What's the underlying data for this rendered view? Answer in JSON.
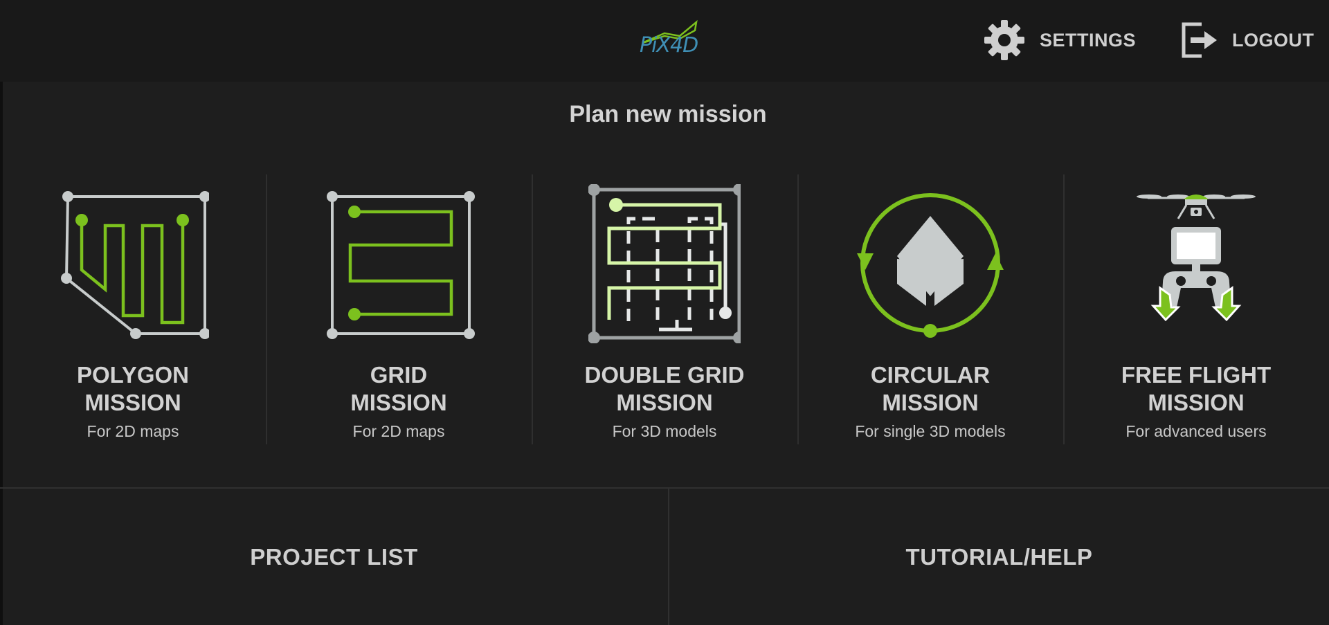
{
  "header": {
    "logo_text": "PiX4D",
    "settings_label": "SETTINGS",
    "logout_label": "LOGOUT"
  },
  "section_title": "Plan new mission",
  "missions": [
    {
      "title_line1": "POLYGON",
      "title_line2": "MISSION",
      "subtitle": "For 2D maps",
      "icon": "polygon-mission-icon"
    },
    {
      "title_line1": "GRID",
      "title_line2": "MISSION",
      "subtitle": "For 2D maps",
      "icon": "grid-mission-icon"
    },
    {
      "title_line1": "DOUBLE GRID",
      "title_line2": "MISSION",
      "subtitle": "For 3D models",
      "icon": "double-grid-mission-icon"
    },
    {
      "title_line1": "CIRCULAR",
      "title_line2": "MISSION",
      "subtitle": "For single 3D models",
      "icon": "circular-mission-icon"
    },
    {
      "title_line1": "FREE FLIGHT",
      "title_line2": "MISSION",
      "subtitle": "For advanced users",
      "icon": "free-flight-mission-icon"
    }
  ],
  "bottom": {
    "project_list_label": "PROJECT LIST",
    "tutorial_label": "TUTORIAL/HELP"
  },
  "colors": {
    "background": "#1e1e1e",
    "header_background": "#191919",
    "accent_green": "#7cc11e",
    "light_green": "#d6f5a8",
    "icon_gray": "#c8cccc",
    "logo_blue": "#3f8fb5"
  }
}
